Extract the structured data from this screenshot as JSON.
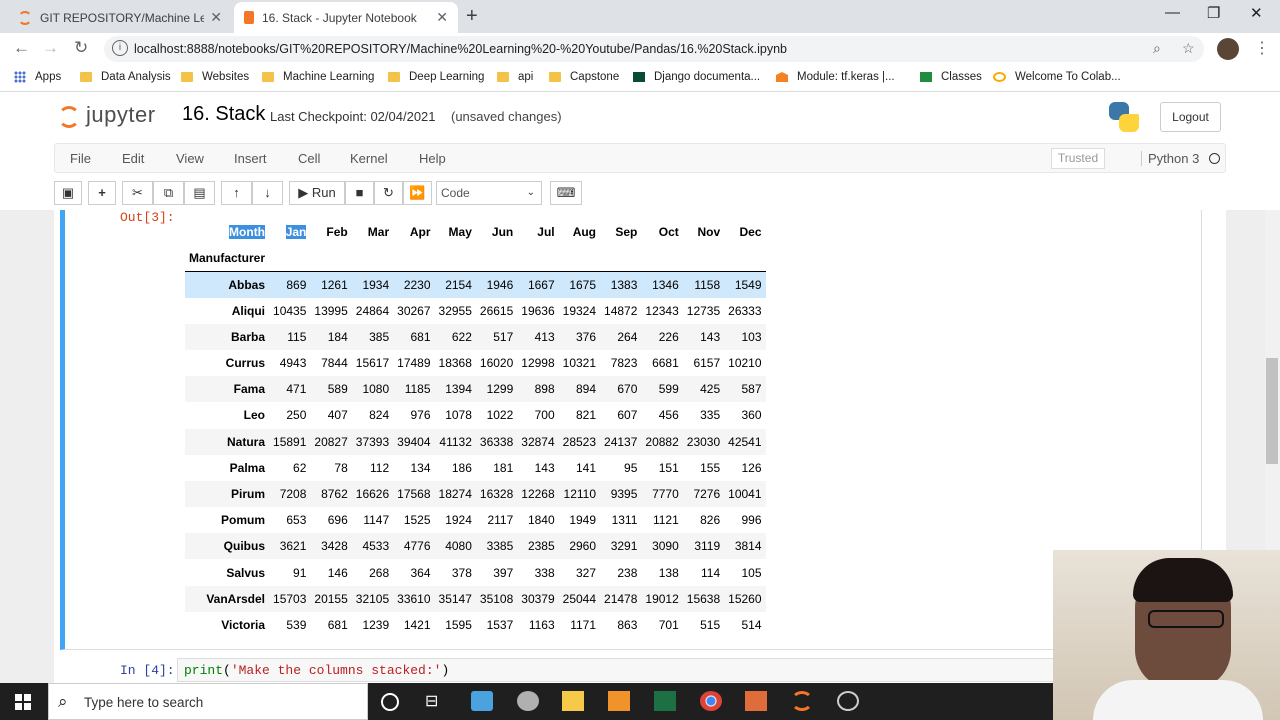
{
  "browser": {
    "tabs": [
      {
        "title": "GIT REPOSITORY/Machine Learni",
        "active": false
      },
      {
        "title": "16. Stack - Jupyter Notebook",
        "active": true
      }
    ],
    "url": "localhost:8888/notebooks/GIT%20REPOSITORY/Machine%20Learning%20-%20Youtube/Pandas/16.%20Stack.ipynb",
    "bookmarks": [
      "Apps",
      "Data Analysis",
      "Websites",
      "Machine Learning",
      "Deep Learning",
      "api",
      "Capstone",
      "Django documenta...",
      "Module: tf.keras |...",
      "Classes",
      "Welcome To Colab..."
    ]
  },
  "jupyter": {
    "logo_text": "jupyter",
    "notebook_name": "16. Stack",
    "checkpoint": "Last Checkpoint: 02/04/2021",
    "unsaved": "(unsaved changes)",
    "logout": "Logout",
    "menus": [
      "File",
      "Edit",
      "View",
      "Insert",
      "Cell",
      "Kernel",
      "Help"
    ],
    "trusted": "Trusted",
    "kernel_name": "Python 3",
    "run_label": "Run",
    "cell_type": "Code"
  },
  "output": {
    "prompt": "Out[3]:",
    "columns": [
      "Month",
      "Jan",
      "Feb",
      "Mar",
      "Apr",
      "May",
      "Jun",
      "Jul",
      "Aug",
      "Sep",
      "Oct",
      "Nov",
      "Dec"
    ],
    "index_name": "Manufacturer",
    "rows": [
      {
        "name": "Abbas",
        "values": [
          "869",
          "1261",
          "1934",
          "2230",
          "2154",
          "1946",
          "1667",
          "1675",
          "1383",
          "1346",
          "1158",
          "1549"
        ]
      },
      {
        "name": "Aliqui",
        "values": [
          "10435",
          "13995",
          "24864",
          "30267",
          "32955",
          "26615",
          "19636",
          "19324",
          "14872",
          "12343",
          "12735",
          "26333"
        ]
      },
      {
        "name": "Barba",
        "values": [
          "115",
          "184",
          "385",
          "681",
          "622",
          "517",
          "413",
          "376",
          "264",
          "226",
          "143",
          "103"
        ]
      },
      {
        "name": "Currus",
        "values": [
          "4943",
          "7844",
          "15617",
          "17489",
          "18368",
          "16020",
          "12998",
          "10321",
          "7823",
          "6681",
          "6157",
          "10210"
        ]
      },
      {
        "name": "Fama",
        "values": [
          "471",
          "589",
          "1080",
          "1185",
          "1394",
          "1299",
          "898",
          "894",
          "670",
          "599",
          "425",
          "587"
        ]
      },
      {
        "name": "Leo",
        "values": [
          "250",
          "407",
          "824",
          "976",
          "1078",
          "1022",
          "700",
          "821",
          "607",
          "456",
          "335",
          "360"
        ]
      },
      {
        "name": "Natura",
        "values": [
          "15891",
          "20827",
          "37393",
          "39404",
          "41132",
          "36338",
          "32874",
          "28523",
          "24137",
          "20882",
          "23030",
          "42541"
        ]
      },
      {
        "name": "Palma",
        "values": [
          "62",
          "78",
          "112",
          "134",
          "186",
          "181",
          "143",
          "141",
          "95",
          "151",
          "155",
          "126"
        ]
      },
      {
        "name": "Pirum",
        "values": [
          "7208",
          "8762",
          "16626",
          "17568",
          "18274",
          "16328",
          "12268",
          "12110",
          "9395",
          "7770",
          "7276",
          "10041"
        ]
      },
      {
        "name": "Pomum",
        "values": [
          "653",
          "696",
          "1147",
          "1525",
          "1924",
          "2117",
          "1840",
          "1949",
          "1311",
          "1121",
          "826",
          "996"
        ]
      },
      {
        "name": "Quibus",
        "values": [
          "3621",
          "3428",
          "4533",
          "4776",
          "4080",
          "3385",
          "2385",
          "2960",
          "3291",
          "3090",
          "3119",
          "3814"
        ]
      },
      {
        "name": "Salvus",
        "values": [
          "91",
          "146",
          "268",
          "364",
          "378",
          "397",
          "338",
          "327",
          "238",
          "138",
          "114",
          "105"
        ]
      },
      {
        "name": "VanArsdel",
        "values": [
          "15703",
          "20155",
          "32105",
          "33610",
          "35147",
          "35108",
          "30379",
          "25044",
          "21478",
          "19012",
          "15638",
          "15260"
        ]
      },
      {
        "name": "Victoria",
        "values": [
          "539",
          "681",
          "1239",
          "1421",
          "1595",
          "1537",
          "1163",
          "1171",
          "863",
          "701",
          "515",
          "514"
        ]
      }
    ]
  },
  "next_cell": {
    "prompt": "In [4]:",
    "code_fn": "print",
    "code_open": "(",
    "code_str": "'Make the columns stacked:'",
    "code_close": ")"
  },
  "taskbar": {
    "search_placeholder": "Type here to search"
  }
}
